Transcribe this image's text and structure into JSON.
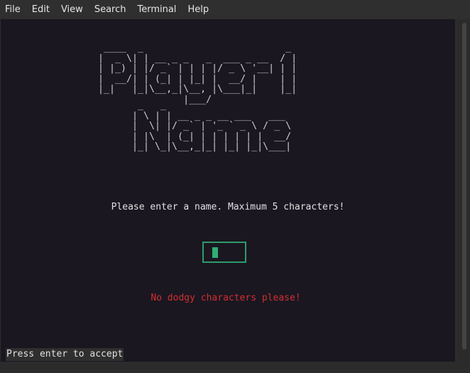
{
  "menubar": {
    "items": [
      "File",
      "Edit",
      "View",
      "Search",
      "Terminal",
      "Help"
    ]
  },
  "title_art": {
    "line1": " ____  _                         _ \n|  _ \\| | __ _ _   _  ___ _ __  / |\n| |_) | |/ _` | | | |/ _ \\ '__| | |\n|  __/| | (_| | |_| |  __/ |    | |\n|_|   |_|\\__,_|\\__, |\\___|_|    |_|\n               |___/               ",
    "line2": " _   _                      \n| \\ | | __ _ _ __ ___   ___ \n|  \\| |/ _` | '_ ` _ \\ / _ \\\n| |\\  | (_| | | | | | |  __/\n|_| \\_|\\__,_|_| |_| |_|\\___|"
  },
  "prompt": "Please enter a name. Maximum 5 characters!",
  "name_input": {
    "value": "",
    "max_length": 5
  },
  "error": "No dodgy characters please!",
  "status_bar": "Press enter to accept",
  "colors": {
    "terminal_bg": "#1a1721",
    "input_border": "#2e9b6a",
    "cursor": "#2fae74",
    "error": "#d12f2f"
  }
}
